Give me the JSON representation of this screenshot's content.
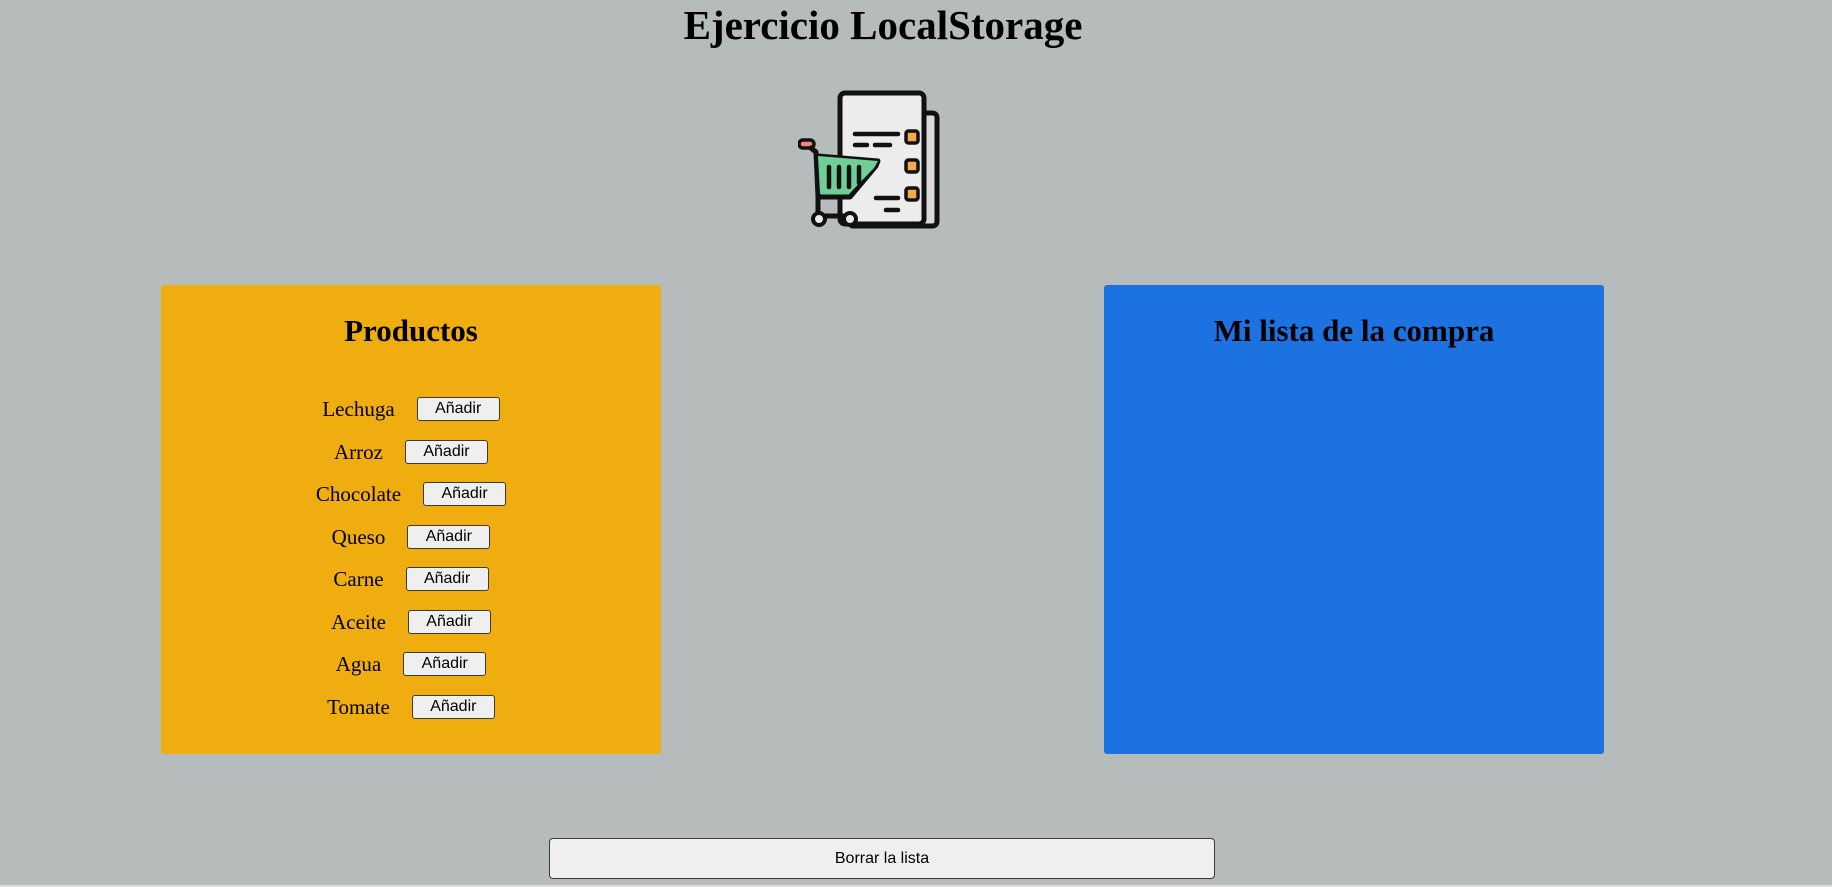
{
  "page": {
    "title": "Ejercicio LocalStorage"
  },
  "logo": {
    "icon": "shopping-list-cart-icon"
  },
  "products_panel": {
    "heading": "Productos",
    "items": [
      {
        "name": "Lechuga",
        "button": "Añadir"
      },
      {
        "name": "Arroz",
        "button": "Añadir"
      },
      {
        "name": "Chocolate",
        "button": "Añadir"
      },
      {
        "name": "Queso",
        "button": "Añadir"
      },
      {
        "name": "Carne",
        "button": "Añadir"
      },
      {
        "name": "Aceite",
        "button": "Añadir"
      },
      {
        "name": "Agua",
        "button": "Añadir"
      },
      {
        "name": "Tomate",
        "button": "Añadir"
      }
    ]
  },
  "list_panel": {
    "heading": "Mi lista de la compra",
    "items": []
  },
  "actions": {
    "clear_label": "Borrar la lista"
  },
  "colors": {
    "background": "#b6bbbc",
    "products_panel": "#f0ad0f",
    "list_panel": "#1c72e1",
    "cart_green": "#6fcf97",
    "checkbox_orange": "#f5a94e"
  }
}
